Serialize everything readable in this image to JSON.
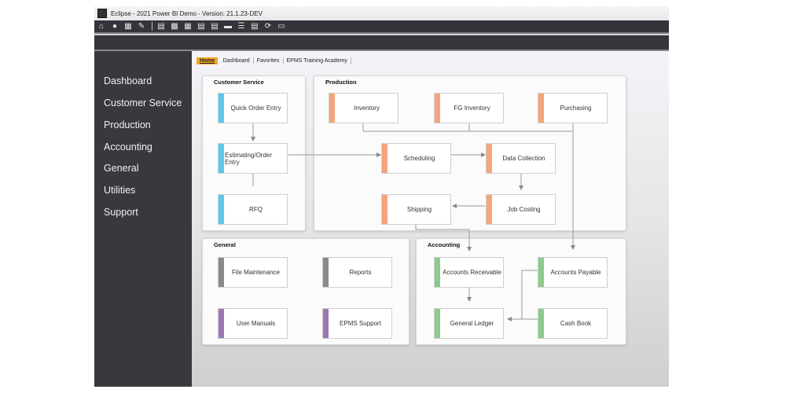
{
  "window": {
    "title": "Eclipse -  2021 Power BI Demo - Version: 21.1.23-DEV"
  },
  "toolbar": {
    "icons": [
      "home-icon",
      "users-icon",
      "building-icon",
      "edit-doc-icon",
      "form-icon",
      "form-edit-icon",
      "grid-icon",
      "doc-export-icon",
      "doc-import-icon",
      "card-icon",
      "list-icon",
      "doc-arrow-icon",
      "refresh-icon",
      "monitor-icon"
    ]
  },
  "sidebar": {
    "items": [
      {
        "label": "Dashboard"
      },
      {
        "label": "Customer Service"
      },
      {
        "label": "Production"
      },
      {
        "label": "Accounting"
      },
      {
        "label": "General"
      },
      {
        "label": "Utilities"
      },
      {
        "label": "Support"
      }
    ]
  },
  "tabs": [
    {
      "label": "Home",
      "active": true
    },
    {
      "label": "Dashboard"
    },
    {
      "label": "Favorites"
    },
    {
      "label": "EPMS Training Academy"
    }
  ],
  "colors": {
    "customer_service": "#5bc8e8",
    "production": "#f5a57c",
    "general_gray": "#8a8a8a",
    "general_purple": "#9a78b4",
    "accounting": "#8ccb8c",
    "active_tab": "#f5a623"
  },
  "panels": {
    "customer_service": {
      "title": "Customer Service",
      "nodes": [
        "Quick Order Entry",
        "Estimating/Order Entry",
        "RFQ"
      ]
    },
    "production": {
      "title": "Production",
      "nodes": [
        "Inventory",
        "FG Inventory",
        "Purchasing",
        "Scheduling",
        "Data Collection",
        "Shipping",
        "Job Costing"
      ]
    },
    "general": {
      "title": "General",
      "nodes": [
        "File Maintenance",
        "Reports",
        "User Manuals",
        "EPMS Support"
      ]
    },
    "accounting": {
      "title": "Accounting",
      "nodes": [
        "Accounts Receivable",
        "Accounts Payable",
        "General Ledger",
        "Cash Book"
      ]
    }
  }
}
